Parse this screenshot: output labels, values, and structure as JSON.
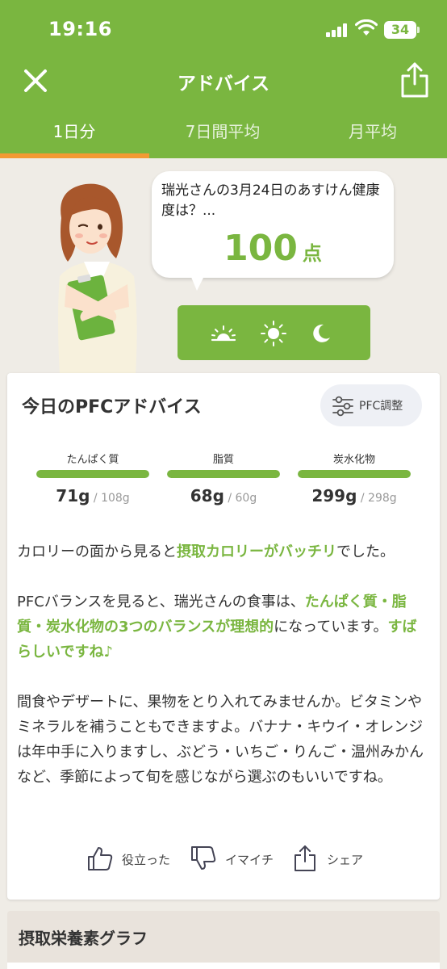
{
  "status_bar": {
    "time": "19:16",
    "battery": "34"
  },
  "nav": {
    "title": "アドバイス",
    "close_icon": "close-icon",
    "share_icon": "share-icon"
  },
  "tabs": [
    {
      "label": "1日分",
      "active": true
    },
    {
      "label": "7日間平均",
      "active": false
    },
    {
      "label": "月平均",
      "active": false
    }
  ],
  "speech": {
    "text": "瑞光さんの3月24日のあすけん健康度は？...",
    "score": "100",
    "unit": "点"
  },
  "meal_times": [
    {
      "icon": "sunrise-icon",
      "meaning": "morning"
    },
    {
      "icon": "sun-icon",
      "meaning": "noon"
    },
    {
      "icon": "moon-icon",
      "meaning": "night"
    }
  ],
  "pfc": {
    "title": "今日のPFCアドバイス",
    "adjust_label": "PFC調整",
    "nutrients": [
      {
        "label": "たんぱく質",
        "value": "71g",
        "target": " / 108g",
        "fill": 1.0
      },
      {
        "label": "脂質",
        "value": "68g",
        "target": " / 60g",
        "fill": 1.0
      },
      {
        "label": "炭水化物",
        "value": "299g",
        "target": " / 298g",
        "fill": 1.0
      }
    ]
  },
  "advice": {
    "p1_a": "カロリーの面から見ると",
    "p1_hl": "摂取カロリーがバッチリ",
    "p1_b": "でした。",
    "p2_a": "PFCバランスを見ると、瑞光さんの食事は、",
    "p2_hl": "たんぱく質・脂質・炭水化物の3つのバランスが理想的",
    "p2_b": "になっています。",
    "p2_hl2": "すばらしいですね♪",
    "p3": "間食やデザートに、果物をとり入れてみませんか。ビタミンやミネラルを補うこともできますよ。バナナ・キウイ・オレンジは年中手に入りますし、ぶどう・いちご・りんご・温州みかんなど、季節によって旬を感じながら選ぶのもいいですね。"
  },
  "actions": {
    "helpful": "役立った",
    "not_good": "イマイチ",
    "share": "シェア"
  },
  "graph_section": {
    "title": "摂取栄養素グラフ"
  },
  "colors": {
    "brand": "#7ab640",
    "tab_indicator": "#f39a33",
    "background": "#efece6"
  }
}
